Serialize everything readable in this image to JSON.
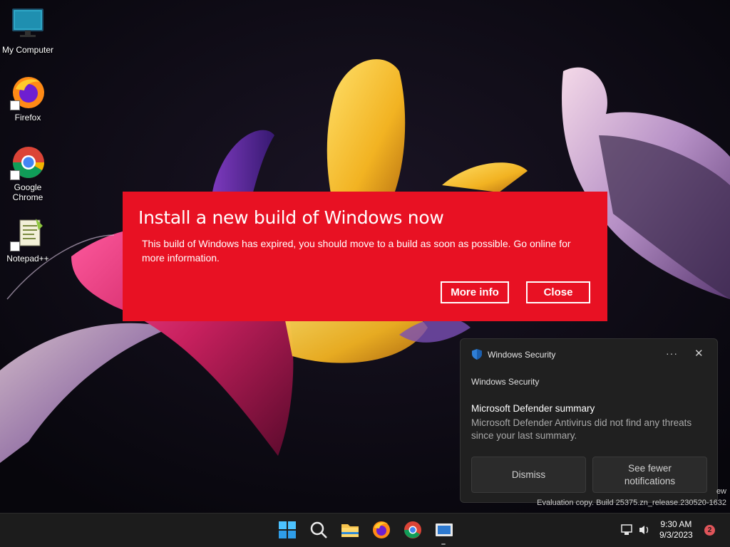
{
  "desktop": {
    "icons": [
      {
        "label": "My Computer",
        "icon": "monitor-icon"
      },
      {
        "label": "Firefox",
        "icon": "firefox-icon"
      },
      {
        "label": "Google Chrome",
        "icon": "chrome-icon"
      },
      {
        "label": "Notepad++",
        "icon": "notepad-plus-plus-icon"
      }
    ]
  },
  "dialog": {
    "title": "Install a new build of Windows now",
    "body": "This build of Windows has expired, you should move to a build as soon as possible. Go online for more information.",
    "more_info_label": "More info",
    "close_label": "Close",
    "background_color": "#e81123"
  },
  "toast": {
    "app_name": "Windows Security",
    "more_label": "···",
    "close_label": "✕",
    "source": "Windows Security",
    "title": "Microsoft Defender summary",
    "body": "Microsoft Defender Antivirus did not find any threats since your last summary.",
    "dismiss_label": "Dismiss",
    "see_fewer_label": "See fewer notifications"
  },
  "watermark": {
    "line1": "ew",
    "line2": "Evaluation copy. Build 25375.zn_release.230520-1632"
  },
  "taskbar": {
    "icons": [
      "windows-start-icon",
      "search-icon",
      "file-explorer-icon",
      "firefox-icon",
      "chrome-icon",
      "active-app-icon"
    ],
    "time": "9:30 AM",
    "date": "9/3/2023",
    "notification_count": "2"
  }
}
